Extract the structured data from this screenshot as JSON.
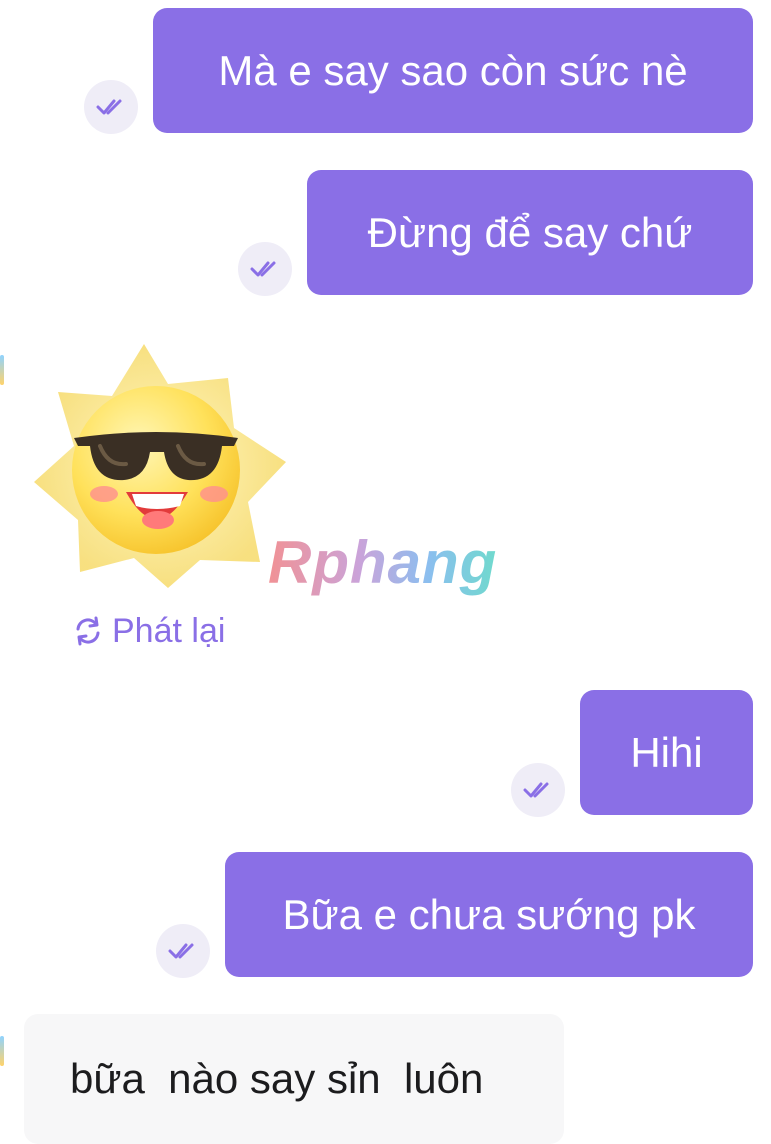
{
  "messages": [
    {
      "text": "Mà e say sao còn sức nè",
      "direction": "out",
      "status_icon": "double-check-icon"
    },
    {
      "text": "Đừng để say chứ",
      "direction": "out",
      "status_icon": "double-check-icon"
    },
    {
      "sticker": "sun-with-sunglasses-sticker",
      "direction": "in",
      "replay_label": "Phát lại",
      "replay_icon": "replay-icon"
    },
    {
      "text": "Hihi",
      "direction": "out",
      "status_icon": "double-check-icon"
    },
    {
      "text": "Bữa e chưa sướng pk",
      "direction": "out",
      "status_icon": "double-check-icon"
    },
    {
      "text": "bữa  nào say sỉn  luôn",
      "direction": "in"
    }
  ],
  "watermark": "Rphang",
  "colors": {
    "outgoing_bubble": "#8a6fe6",
    "incoming_bubble": "#f7f7f8",
    "status_circle": "#efedf7",
    "accent": "#8a6fe6"
  }
}
